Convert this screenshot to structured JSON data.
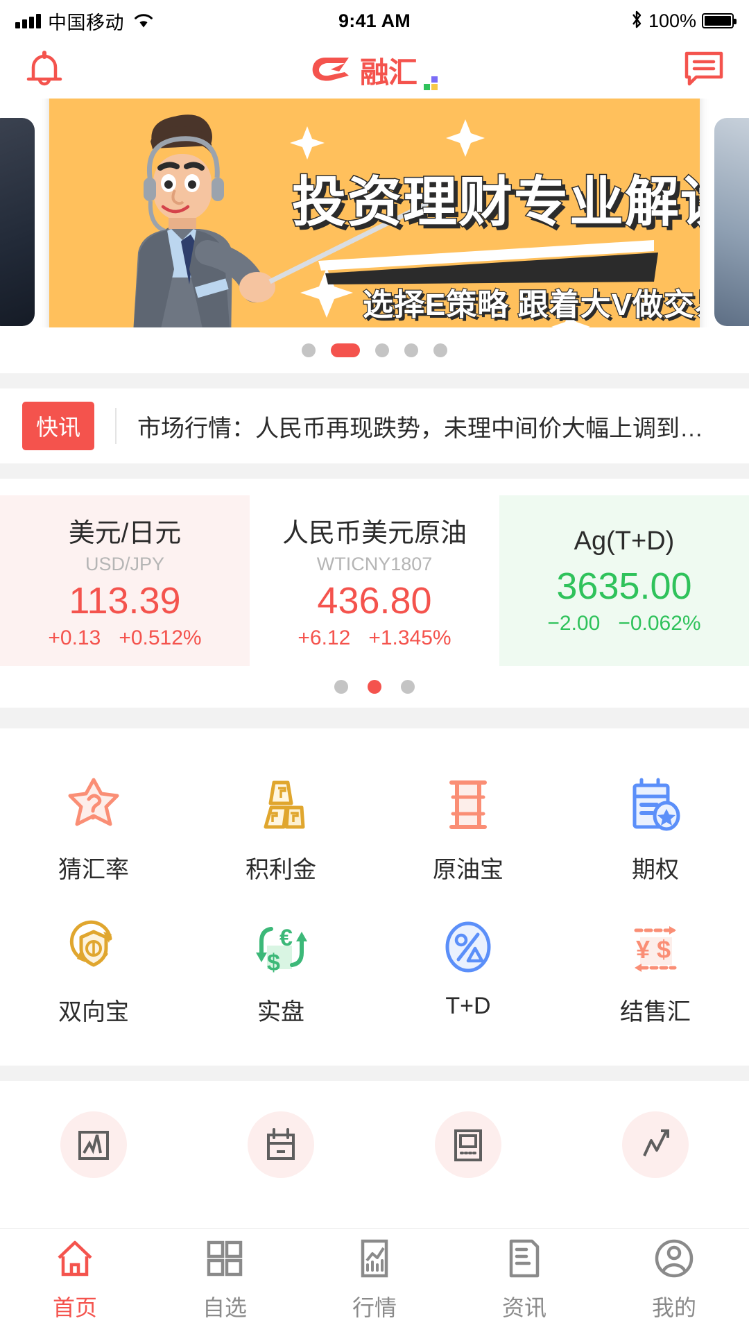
{
  "status_bar": {
    "carrier": "中国移动",
    "time": "9:41 AM",
    "battery_percent": "100%",
    "icons": [
      "signal-icon",
      "wifi-icon",
      "bluetooth-icon",
      "battery-icon"
    ]
  },
  "header": {
    "logo_text": "融汇",
    "bell_icon": "bell-icon",
    "chat_icon": "chat-bubble-icon",
    "brand_color": "#f4534d",
    "logo_dot_colors": [
      "#7b6cf6",
      "#ffffff",
      "#2fc25b",
      "#f7c948"
    ]
  },
  "banner": {
    "headline": "投资理财专业解读",
    "subline": "选择E策略  跟着大V做交易",
    "background_color": "#ffc05c",
    "dots": {
      "count": 5,
      "active_index": 1
    }
  },
  "news": {
    "badge": "快讯",
    "text": "市场行情：人民币再现跌势，未理中间价大幅上调到…"
  },
  "quotes": {
    "items": [
      {
        "name": "美元/日元",
        "code": "USD/JPY",
        "price": "113.39",
        "change": "+0.13",
        "percent": "+0.512%",
        "direction": "up"
      },
      {
        "name": "人民币美元原油",
        "code": "WTICNY1807",
        "price": "436.80",
        "change": "+6.12",
        "percent": "+1.345%",
        "direction": "flat"
      },
      {
        "name": "Ag(T+D)",
        "code": "",
        "price": "3635.00",
        "change": "−2.00",
        "percent": "−0.062%",
        "direction": "down"
      }
    ],
    "dots": {
      "count": 3,
      "active_index": 1
    },
    "up_color": "#f4534d",
    "down_color": "#2fc25b"
  },
  "features": {
    "row1": [
      {
        "label": "猜汇率",
        "icon": "star-question-icon",
        "color": "#fa8e75"
      },
      {
        "label": "积利金",
        "icon": "gold-bars-icon",
        "color": "#e0a62e"
      },
      {
        "label": "原油宝",
        "icon": "oil-barrel-icon",
        "color": "#fa8e75"
      },
      {
        "label": "期权",
        "icon": "calendar-star-icon",
        "color": "#5b8ff9"
      }
    ],
    "row2": [
      {
        "label": "双向宝",
        "icon": "shield-dollar-icon",
        "color": "#e0a62e"
      },
      {
        "label": "实盘",
        "icon": "currency-exchange-icon",
        "color": "#3cb878"
      },
      {
        "label": "T+D",
        "icon": "percent-circle-icon",
        "color": "#5b8ff9"
      },
      {
        "label": "结售汇",
        "icon": "yen-dollar-icon",
        "color": "#fa8e75"
      }
    ],
    "row3_partial": [
      {
        "icon": "chart-frame-icon"
      },
      {
        "icon": "calendar-icon"
      },
      {
        "icon": "monitor-icon"
      },
      {
        "icon": "trend-line-icon"
      }
    ]
  },
  "tabbar": {
    "items": [
      {
        "label": "首页",
        "icon": "home-icon",
        "active": true
      },
      {
        "label": "自选",
        "icon": "grid-icon",
        "active": false
      },
      {
        "label": "行情",
        "icon": "market-chart-icon",
        "active": false
      },
      {
        "label": "资讯",
        "icon": "news-icon",
        "active": false
      },
      {
        "label": "我的",
        "icon": "person-icon",
        "active": false
      }
    ],
    "active_color": "#f4534d",
    "inactive_color": "#8a8a8a"
  }
}
